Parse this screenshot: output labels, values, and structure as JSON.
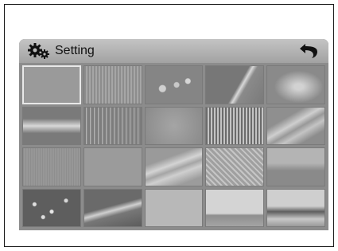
{
  "header": {
    "title": "Setting",
    "settings_icon": "gears-icon",
    "back_icon": "back-arrow-icon"
  },
  "wallpapers": {
    "count": 20,
    "selected_index": 0,
    "items": [
      "w0",
      "w1",
      "w2",
      "w3",
      "w4",
      "w5",
      "w6",
      "w7",
      "w8",
      "w9",
      "w10",
      "w11",
      "w12",
      "w13",
      "w14",
      "w15",
      "w16",
      "w17",
      "w18",
      "w19"
    ]
  },
  "colors": {
    "panel": "#8c8c8c",
    "titlebar": "#b4b4b4",
    "frame": "#1a1a1a"
  }
}
